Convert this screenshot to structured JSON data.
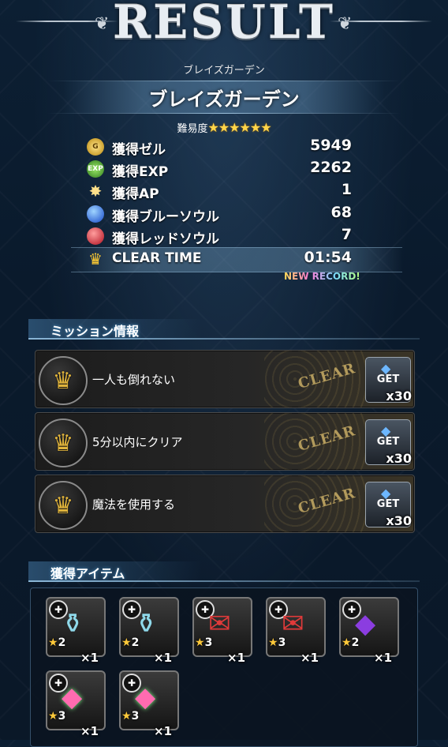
{
  "header": {
    "title": "RESULT",
    "stage_small": "ブレイズガーデン",
    "stage_name": "ブレイズガーデン",
    "difficulty_label": "難易度",
    "difficulty_stars": "★★★★★★"
  },
  "rewards": [
    {
      "icon": "gil-coin-icon",
      "label": "獲得ゼル",
      "value": "5949"
    },
    {
      "icon": "exp-icon",
      "label": "獲得EXP",
      "value": "2262"
    },
    {
      "icon": "ap-star-icon",
      "label": "獲得AP",
      "value": "1"
    },
    {
      "icon": "blue-soul-icon",
      "label": "獲得ブルーソウル",
      "value": "68"
    },
    {
      "icon": "red-soul-icon",
      "label": "獲得レッドソウル",
      "value": "7"
    },
    {
      "icon": "trophy-icon",
      "label": "CLEAR TIME",
      "value": "01:54"
    }
  ],
  "new_record": "NEW RECORD!",
  "missions_section": {
    "title": "ミッション情報",
    "items": [
      {
        "text": "一人も倒れない",
        "status": "CLEAR",
        "get_label": "GET",
        "count": "x30"
      },
      {
        "text": "5分以内にクリア",
        "status": "CLEAR",
        "get_label": "GET",
        "count": "x30"
      },
      {
        "text": "魔法を使用する",
        "status": "CLEAR",
        "get_label": "GET",
        "count": "x30"
      }
    ]
  },
  "items_section": {
    "title": "獲得アイテム",
    "items": [
      {
        "icon": "potion-icon",
        "rarity": "2",
        "qty": "×1"
      },
      {
        "icon": "potion-icon",
        "rarity": "2",
        "qty": "×1"
      },
      {
        "icon": "red-crystal-envelope-icon",
        "rarity": "3",
        "qty": "×1"
      },
      {
        "icon": "red-crystal-envelope-icon",
        "rarity": "3",
        "qty": "×1"
      },
      {
        "icon": "purple-crystal-icon",
        "rarity": "2",
        "qty": "×1"
      },
      {
        "icon": "rainbow-crystal-icon",
        "rarity": "3",
        "qty": "×1"
      },
      {
        "icon": "rainbow-crystal-icon",
        "rarity": "3",
        "qty": "×1"
      }
    ]
  },
  "colors": {
    "star_gold": "#ffd54a",
    "accent_blue": "#8ab6d6",
    "clear_gold": "#dcbe6e"
  }
}
